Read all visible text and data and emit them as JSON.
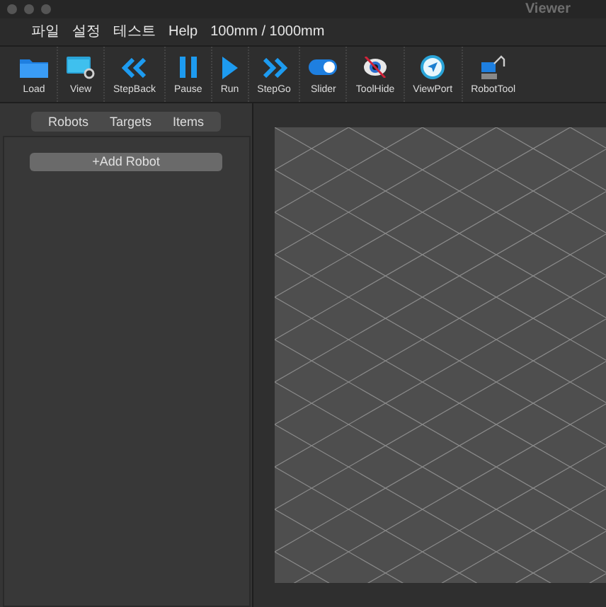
{
  "window": {
    "title": "Viewer"
  },
  "menu": [
    "파일",
    "설정",
    "테스트",
    "Help",
    "100mm / 1000mm"
  ],
  "toolbar": [
    {
      "label": "Load",
      "kind": "folder"
    },
    {
      "label": "View",
      "kind": "view"
    },
    {
      "label": "StepBack",
      "kind": "stepback"
    },
    {
      "label": "Pause",
      "kind": "pause"
    },
    {
      "label": "Run",
      "kind": "run"
    },
    {
      "label": "StepGo",
      "kind": "stepgo"
    },
    {
      "label": "Slider",
      "kind": "toggle"
    },
    {
      "label": "ToolHide",
      "kind": "hide"
    },
    {
      "label": "ViewPort",
      "kind": "viewport"
    },
    {
      "label": "RobotTool",
      "kind": "robot"
    }
  ],
  "tabs": [
    {
      "label": "Robots",
      "selected": false
    },
    {
      "label": "Targets",
      "selected": false
    },
    {
      "label": "Items",
      "selected": false
    }
  ],
  "add_button": "+Add Robot"
}
